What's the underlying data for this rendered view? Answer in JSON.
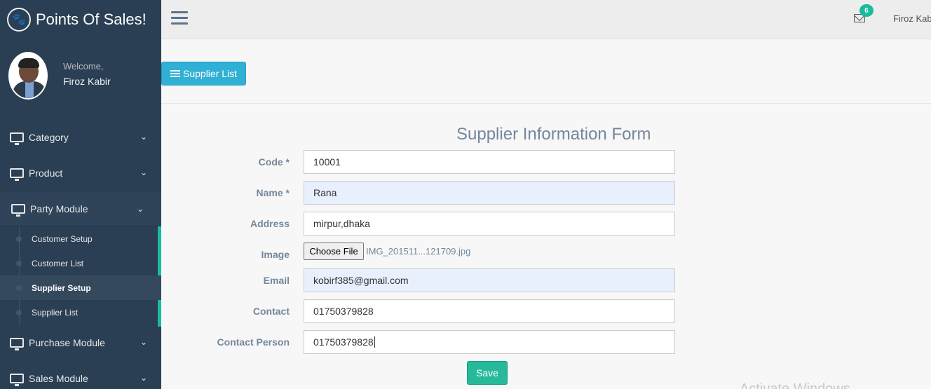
{
  "brand": {
    "title": "Points Of Sales!",
    "icon": "paw-icon"
  },
  "profile": {
    "welcome": "Welcome,",
    "name": "Firoz Kabir"
  },
  "sidebar": {
    "items": [
      {
        "label": "Category",
        "icon": "monitor-icon"
      },
      {
        "label": "Product",
        "icon": "monitor-icon"
      },
      {
        "label": "Party Module",
        "icon": "monitor-icon"
      },
      {
        "label": "Purchase Module",
        "icon": "monitor-icon"
      },
      {
        "label": "Sales Module",
        "icon": "monitor-icon"
      }
    ],
    "party_sub": [
      "Customer Setup",
      "Customer List",
      "Supplier Setup",
      "Supplier List"
    ]
  },
  "topnav": {
    "mail_count": "6",
    "user": "Firoz Kabir"
  },
  "toolbar": {
    "supplier_list_label": "Supplier List"
  },
  "form": {
    "title": "Supplier Information Form",
    "code_label": "Code *",
    "code_value": "10001",
    "name_label": "Name *",
    "name_value": "Rana",
    "address_label": "Address",
    "address_value": "mirpur,dhaka",
    "image_label": "Image",
    "choose_file": "Choose File",
    "file_name": "IMG_201511...121709.jpg",
    "email_label": "Email",
    "email_value": "kobirf385@gmail.com",
    "contact_label": "Contact",
    "contact_value": "01750379828",
    "contact_person_label": "Contact Person",
    "contact_person_value": "01750379828",
    "save_label": "Save"
  },
  "watermark": "Activate Windows",
  "colors": {
    "sidebar": "#2a3f54",
    "accent": "#1abb9c",
    "info": "#31b0d5",
    "success": "#26b99a"
  }
}
